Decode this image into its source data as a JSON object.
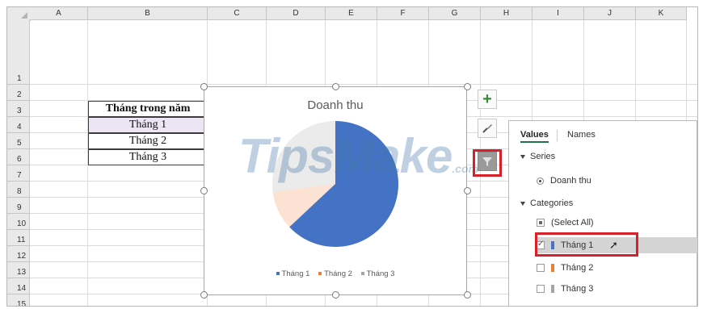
{
  "columns": [
    "A",
    "B",
    "C",
    "D",
    "E",
    "F",
    "G",
    "H",
    "I",
    "J",
    "K"
  ],
  "rows": [
    "1",
    "2",
    "3",
    "4",
    "5",
    "6",
    "7",
    "8",
    "9",
    "10",
    "11",
    "12",
    "13",
    "14",
    "15"
  ],
  "table": {
    "header": "Tháng trong năm",
    "cells": [
      "Tháng 1",
      "Tháng 2",
      "Tháng 3"
    ]
  },
  "chart_data": {
    "type": "pie",
    "title": "Doanh thu",
    "categories": [
      "Tháng 1",
      "Tháng 2",
      "Tháng 3"
    ],
    "series": [
      {
        "name": "Doanh thu",
        "values": [
          0.63,
          0.1,
          0.27
        ]
      }
    ],
    "visible_in_plot": [
      true,
      false,
      false
    ],
    "colors": [
      "#4472c4",
      "#ed7d31",
      "#a5a5a5"
    ],
    "legend_position": "bottom"
  },
  "watermark": {
    "text": "TipsMake",
    "suffix": ".com"
  },
  "filter_pane": {
    "tabs": {
      "values": "Values",
      "names": "Names"
    },
    "series_heading": "Series",
    "series_item": "Doanh thu",
    "categories_heading": "Categories",
    "select_all": "(Select All)",
    "items": [
      {
        "label": "Tháng 1",
        "checked": true,
        "color": "#4472c4"
      },
      {
        "label": "Tháng 2",
        "checked": false,
        "color": "#ed7d31"
      },
      {
        "label": "Tháng 3",
        "checked": false,
        "color": "#a5a5a5"
      }
    ]
  },
  "side_buttons": {
    "elements": "chart-elements-icon",
    "styles": "chart-styles-icon",
    "filters": "chart-filters-icon"
  },
  "colors": {
    "highlight": "#d8202a",
    "plus": "#3a8a3a"
  }
}
